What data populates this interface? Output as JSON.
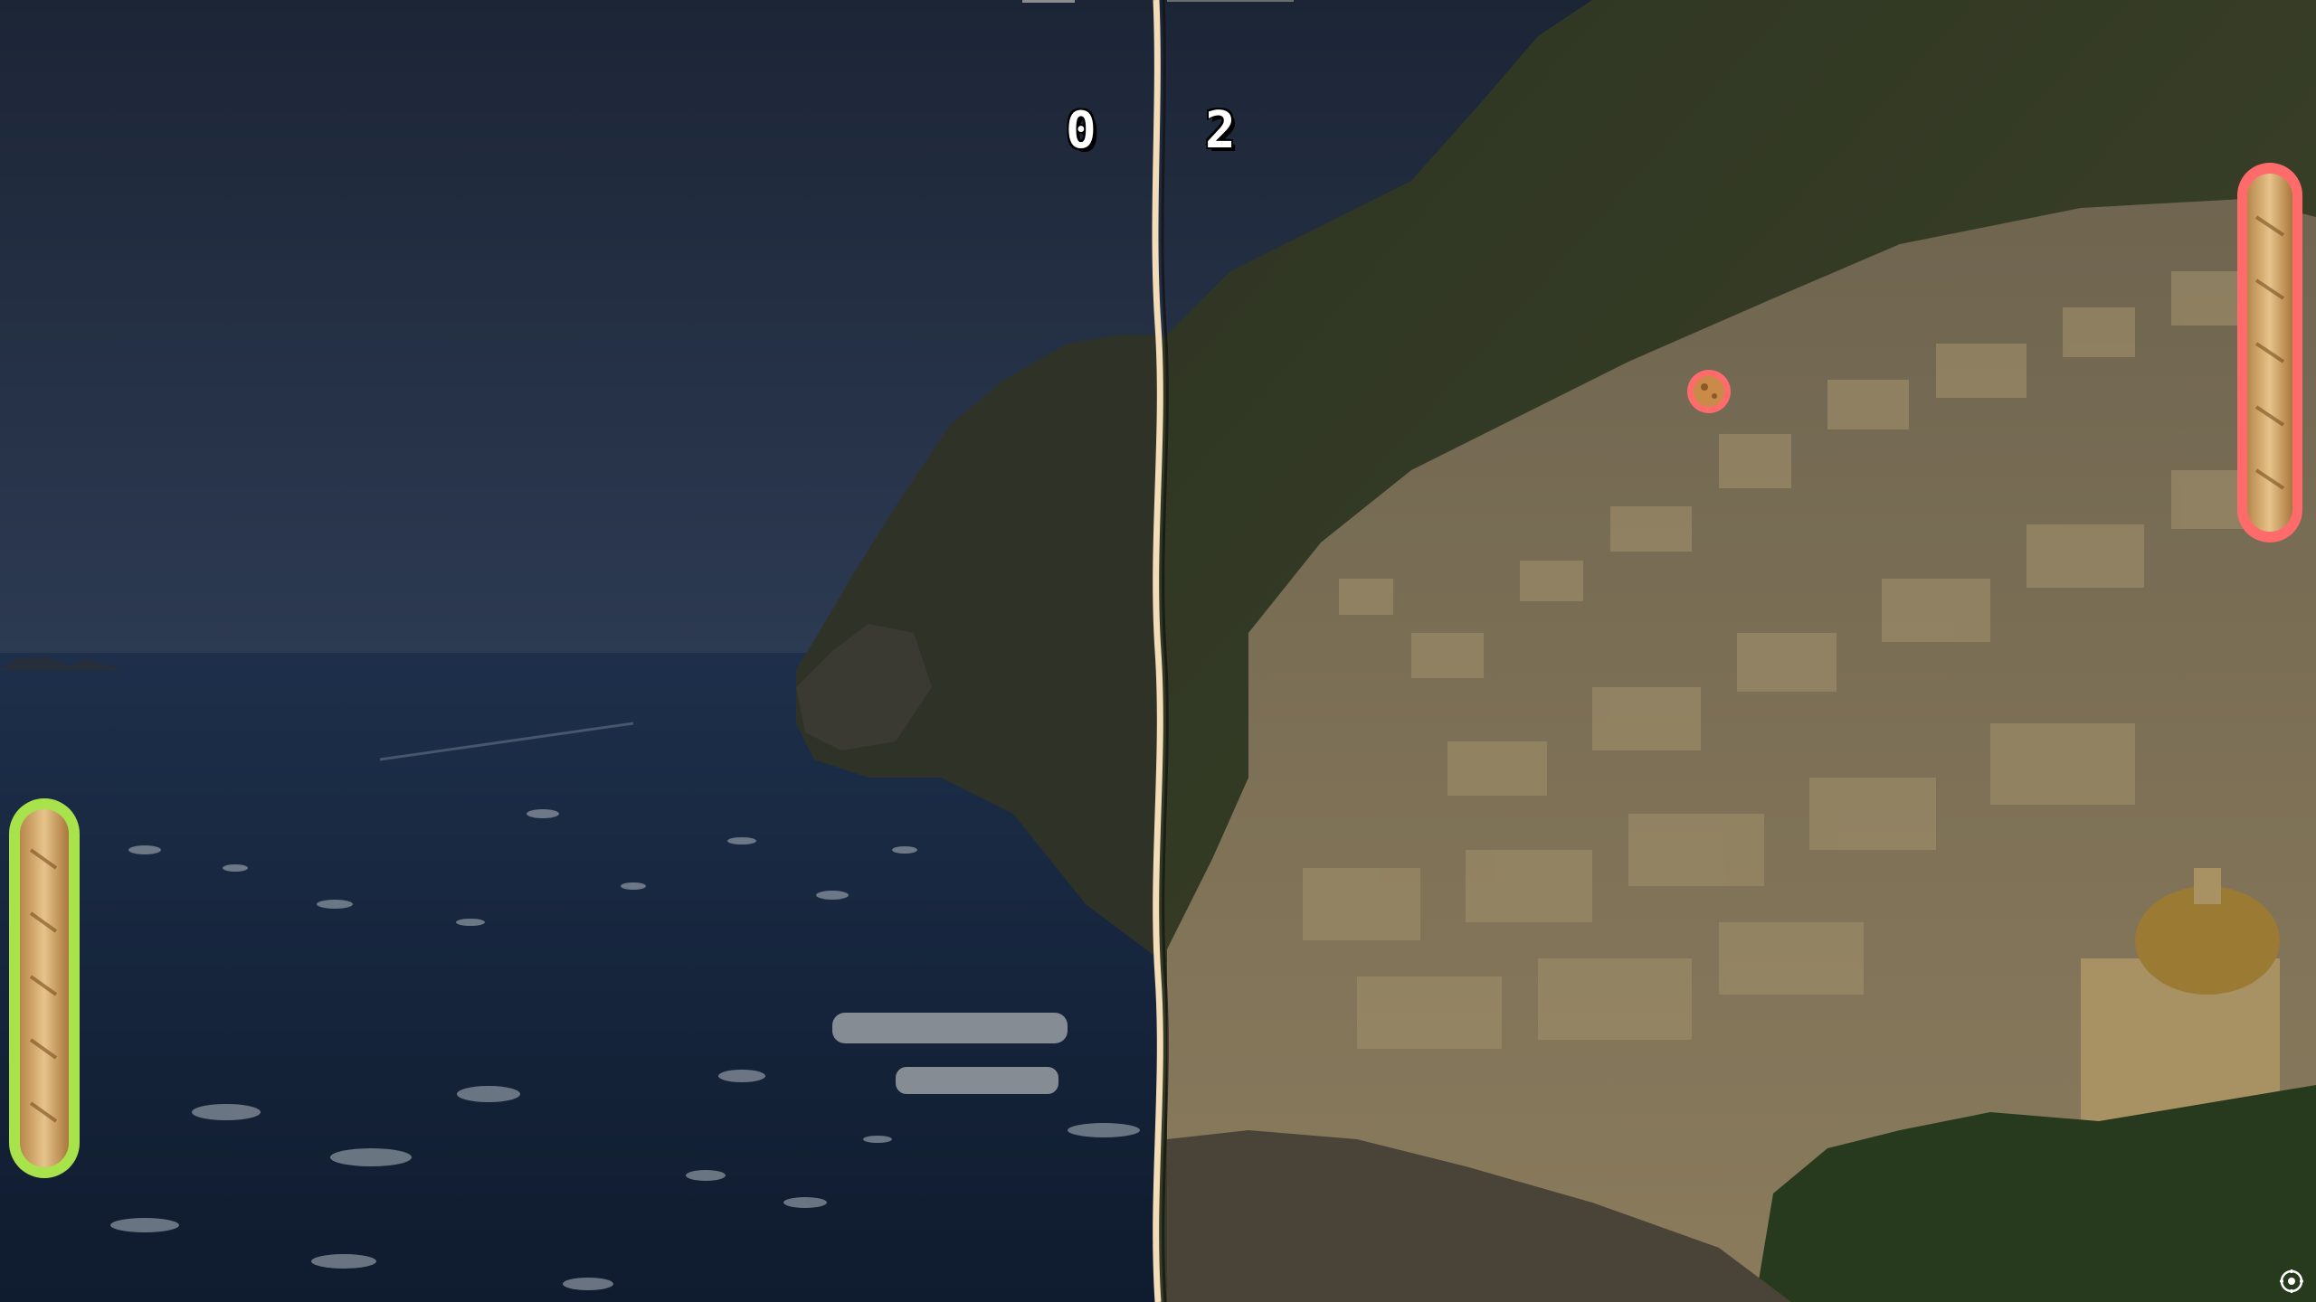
{
  "game": {
    "left_score": "0",
    "right_score": "2",
    "left_paddle": {
      "item": "baguette",
      "outline_color": "#a9e34b"
    },
    "right_paddle": {
      "item": "baguette",
      "outline_color": "#ff6b6b"
    },
    "ball": {
      "outline_color": "#ff6b6b"
    },
    "net": {
      "color": "#f3dcb8"
    }
  },
  "controls": {
    "settings_icon": "gear-icon"
  }
}
